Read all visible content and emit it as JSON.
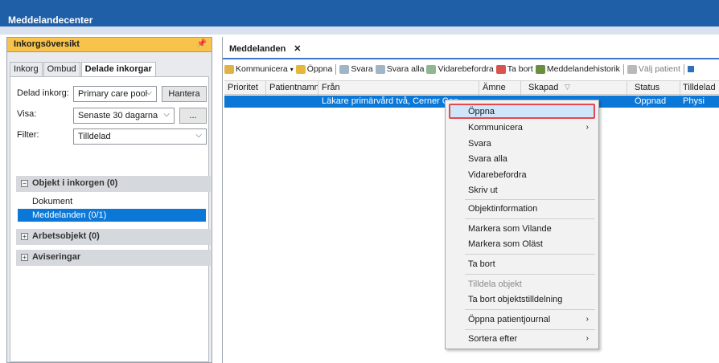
{
  "app": {
    "title": "Meddelandecenter"
  },
  "left_pane": {
    "title": "Inkorgsöversikt",
    "tabs": [
      "Inkorg",
      "Ombud",
      "Delade inkorgar"
    ],
    "shared_inbox_label": "Delad inkorg:",
    "shared_inbox_value": "Primary care pool",
    "manage_button": "Hantera",
    "show_label": "Visa:",
    "show_value": "Senaste 30 dagarna",
    "more_button": "...",
    "filter_label": "Filter:",
    "filter_value": "Tilldelad",
    "sections": {
      "inbox_objects": "Objekt i inkorgen (0)",
      "documents": "Dokument",
      "messages": "Meddelanden (0/1)",
      "work_items": "Arbetsobjekt (0)",
      "notifications": "Aviseringar"
    }
  },
  "right_pane": {
    "tab_title": "Meddelanden",
    "tab_close": "✕",
    "toolbar": {
      "communicate": "Kommunicera",
      "open": "Öppna",
      "reply": "Svara",
      "reply_all": "Svara alla",
      "forward": "Vidarebefordra",
      "delete": "Ta bort",
      "history": "Meddelandehistorik",
      "select_patient": "Välj patient"
    },
    "columns": [
      "Prioritet",
      "Patientnamn",
      "Från",
      "Ämne",
      "Skapad",
      "Status",
      "Tilldelad"
    ],
    "row": {
      "from": "Läkare primärvård två, Cerner Cen",
      "status": "Öppnad",
      "assigned": "Physi"
    }
  },
  "context_menu": {
    "items": [
      "Öppna",
      "Kommunicera",
      "Svara",
      "Svara alla",
      "Vidarebefordra",
      "Skriv ut",
      "Objektinformation",
      "Markera som Vilande",
      "Markera som Oläst",
      "Ta bort",
      "Tilldela objekt",
      "Ta bort objektstilldelning",
      "Öppna patientjournal",
      "Sortera efter"
    ]
  },
  "colors": {
    "title_bar": "#1f5fa8",
    "selection": "#0b78d7",
    "panel_header": "#f7c34a",
    "highlight_border": "#e5484d"
  }
}
